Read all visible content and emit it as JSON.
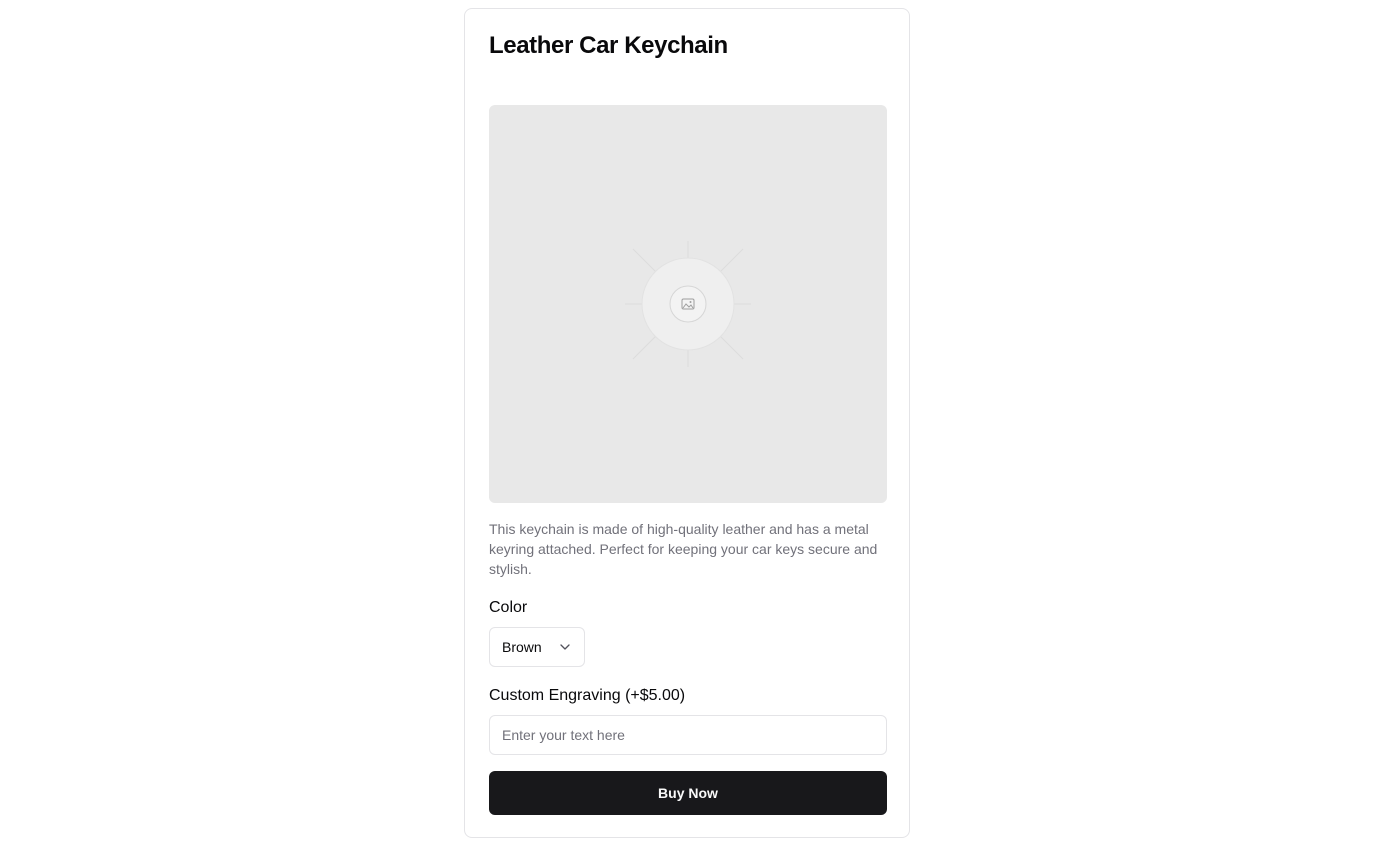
{
  "product": {
    "title": "Leather Car Keychain",
    "image_placeholder_icon": "image-icon",
    "description": "This keychain is made of high-quality leather and has a metal keyring attached. Perfect for keeping your car keys secure and stylish."
  },
  "color": {
    "label": "Color",
    "selected": "Brown"
  },
  "engraving": {
    "label": "Custom Engraving (+$5.00)",
    "placeholder": "Enter your text here",
    "value": ""
  },
  "actions": {
    "buy_label": "Buy Now"
  },
  "theme": {
    "button_bg": "#18181b",
    "muted_text": "#71717a",
    "border": "#e4e4e7",
    "image_bg": "#e8e8e8"
  }
}
